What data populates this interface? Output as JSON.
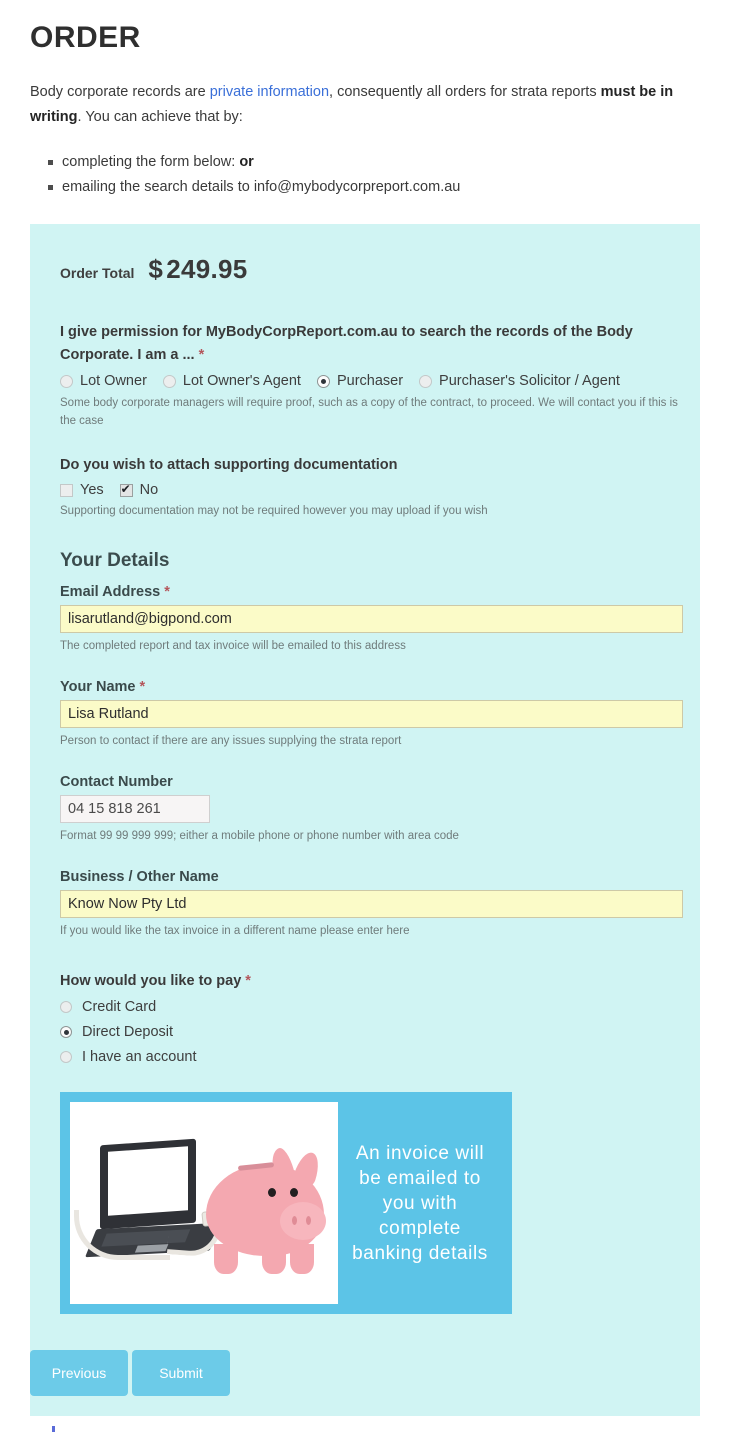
{
  "page": {
    "title": "ORDER",
    "intro": {
      "part1": "Body corporate records are ",
      "link": "private information",
      "part2": ", consequently all orders for strata reports ",
      "bold": "must be in writing",
      "part3": ". You can achieve that by:"
    },
    "bullets": [
      {
        "text": "completing the form below: ",
        "bold": "or"
      },
      {
        "text": "emailing the search details to info@mybodycorpreport.com.au",
        "bold": ""
      }
    ]
  },
  "form": {
    "order_total": {
      "label": "Order Total",
      "currency": "$",
      "amount": "249.95"
    },
    "permission": {
      "question": "I give permission for MyBodyCorpReport.com.au to search the records of the Body Corporate. I am a ...",
      "required": "*",
      "options": [
        {
          "label": "Lot Owner",
          "selected": false
        },
        {
          "label": "Lot Owner's Agent",
          "selected": false
        },
        {
          "label": "Purchaser",
          "selected": true
        },
        {
          "label": "Purchaser's Solicitor / Agent",
          "selected": false
        }
      ],
      "hint": "Some body corporate managers will require proof, such as a copy of the contract, to proceed. We will contact you if this is the case"
    },
    "documentation": {
      "question": "Do you wish to attach supporting documentation",
      "options": [
        {
          "label": "Yes",
          "checked": false
        },
        {
          "label": "No",
          "checked": true
        }
      ],
      "hint": "Supporting documentation may not be required however you may upload if you wish"
    },
    "your_details": {
      "heading": "Your Details",
      "fields": [
        {
          "label": "Email Address",
          "required": "*",
          "value": "lisarutland@bigpond.com",
          "hint": "The completed report and tax invoice will be emailed to this address"
        },
        {
          "label": "Your Name",
          "required": "*",
          "value": "Lisa Rutland",
          "hint": "Person to contact if there are any issues supplying the strata report"
        },
        {
          "label": "Contact Number",
          "required": "",
          "value": "04 15 818 261",
          "hint": "Format 99 99 999 999; either a mobile phone or phone number with area code"
        },
        {
          "label": "Business / Other Name",
          "required": "",
          "value": "Know Now Pty Ltd",
          "hint": "If you would like the tax invoice in a different name please enter here"
        }
      ]
    },
    "payment": {
      "question": "How would you like to pay",
      "required": "*",
      "options": [
        {
          "label": "Credit Card",
          "selected": false
        },
        {
          "label": "Direct Deposit",
          "selected": true
        },
        {
          "label": "I have an account",
          "selected": false
        }
      ]
    },
    "banner": {
      "text": "An invoice will be emailed to you with complete banking details",
      "background": "#5cc4e7"
    },
    "buttons": {
      "previous": "Previous",
      "submit": "Submit"
    }
  },
  "colors": {
    "panel_background": "#d0f4f3",
    "button": "#6ccbe8",
    "input_highlight": "#fbfbc8",
    "link": "#3a6fd8",
    "required_marker": "#b4565b"
  }
}
